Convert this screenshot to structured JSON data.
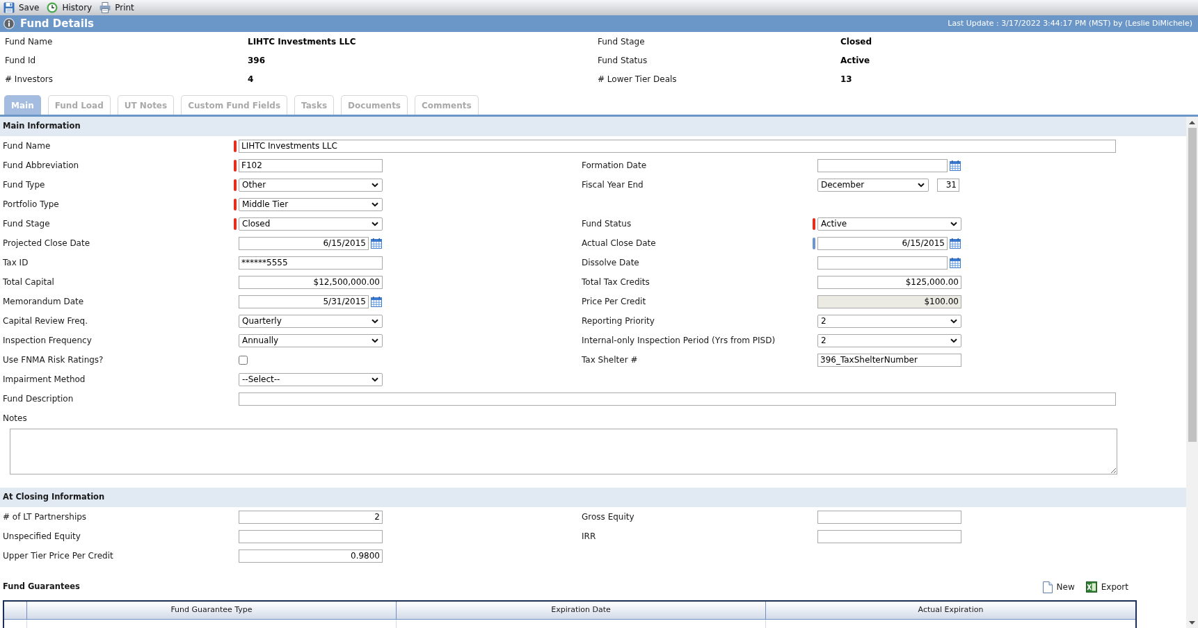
{
  "toolbar": [
    {
      "label": "Save"
    },
    {
      "label": "History"
    },
    {
      "label": "Print"
    }
  ],
  "header": {
    "title": "Fund Details",
    "last_update": "Last Update : 3/17/2022 3:44:17 PM (MST) by (Leslie DiMichele)"
  },
  "summary": [
    {
      "label": "Fund Name",
      "value": "LIHTC Investments LLC"
    },
    {
      "label": "Fund Stage",
      "value": "Closed"
    },
    {
      "label": "Fund Id",
      "value": "396"
    },
    {
      "label": "Fund Status",
      "value": "Active"
    },
    {
      "label": "# Investors",
      "value": "4"
    },
    {
      "label": "# Lower Tier Deals",
      "value": "13"
    }
  ],
  "tabs": [
    {
      "label": "Main",
      "selected": true
    },
    {
      "label": "Fund Load",
      "selected": false
    },
    {
      "label": "UT Notes",
      "selected": false
    },
    {
      "label": "Custom Fund Fields",
      "selected": false
    },
    {
      "label": "Tasks",
      "selected": false
    },
    {
      "label": "Documents",
      "selected": false
    },
    {
      "label": "Comments",
      "selected": false
    }
  ],
  "sections": [
    {
      "title": "Main Information",
      "rows": [
        {
          "wide": {
            "label": "Fund Name",
            "kind": "text",
            "value": "LIHTC Investments LLC",
            "disabled": false,
            "marker": {
              "color": "#e62e1f"
            }
          }
        },
        {
          "left": {
            "label": "Fund Abbreviation",
            "kind": "text",
            "value": "F102",
            "disabled": false,
            "marker": {
              "color": "#e62e1f"
            }
          },
          "right": {
            "label": "Formation Date",
            "kind": "date",
            "disabled": false
          }
        },
        {
          "left": {
            "label": "Fund Type",
            "kind": "select",
            "value": "Other",
            "disabled": false,
            "marker": {
              "color": "#e62e1f"
            }
          },
          "right": {
            "label": "Fiscal Year End",
            "kind": "month_day",
            "value": "December",
            "day": "31",
            "disabled": false
          }
        },
        {
          "left": {
            "label": "Portfolio Type",
            "kind": "select",
            "value": "Middle Tier",
            "disabled": false,
            "marker": {
              "color": "#e62e1f"
            }
          }
        },
        {
          "left": {
            "label": "Fund Stage",
            "kind": "select",
            "value": "Closed",
            "disabled": false,
            "marker": {
              "color": "#e62e1f"
            }
          },
          "right": {
            "label": "Fund Status",
            "kind": "select",
            "value": "Active",
            "disabled": false,
            "marker": {
              "color": "#e62e1f"
            }
          }
        },
        {
          "left": {
            "label": "Projected Close Date",
            "kind": "date",
            "value": "6/15/2015",
            "disabled": false
          },
          "right": {
            "label": "Actual Close Date",
            "kind": "date",
            "value": "6/15/2015",
            "disabled": false,
            "marker": {
              "color": "#6f96c9"
            }
          }
        },
        {
          "left": {
            "label": "Tax ID",
            "kind": "text",
            "value": "******5555",
            "disabled": false
          },
          "right": {
            "label": "Dissolve Date",
            "kind": "date",
            "disabled": false
          }
        },
        {
          "left": {
            "label": "Total Capital",
            "kind": "number",
            "value": "$12,500,000.00",
            "disabled": false
          },
          "right": {
            "label": "Total Tax Credits",
            "kind": "number",
            "value": "$125,000.00",
            "disabled": false
          }
        },
        {
          "left": {
            "label": "Memorandum Date",
            "kind": "date",
            "value": "5/31/2015",
            "disabled": false
          },
          "right": {
            "label": "Price Per Credit",
            "kind": "number",
            "value": "$100.00",
            "disabled": true
          }
        },
        {
          "left": {
            "label": "Capital Review Freq.",
            "kind": "select",
            "value": "Quarterly",
            "disabled": false
          },
          "right": {
            "label": "Reporting Priority",
            "kind": "select",
            "value": "2",
            "disabled": false
          }
        },
        {
          "left": {
            "label": "Inspection Frequency",
            "kind": "select",
            "value": "Annually",
            "disabled": false
          },
          "right": {
            "label": "Internal-only Inspection Period (Yrs from PISD)",
            "kind": "select",
            "value": "2",
            "disabled": false
          }
        },
        {
          "left": {
            "label": "Use FNMA Risk Ratings?",
            "kind": "checkbox",
            "checked": false,
            "disabled": false
          },
          "right": {
            "label": "Tax Shelter #",
            "kind": "text",
            "value": "396_TaxShelterNumber",
            "disabled": false
          }
        },
        {
          "left": {
            "label": "Impairment Method",
            "kind": "select",
            "value": "--Select--",
            "disabled": false
          }
        },
        {
          "wide": {
            "label": "Fund Description",
            "kind": "text",
            "disabled": false
          }
        },
        {
          "wide": {
            "label": "Notes",
            "kind": "textarea",
            "disabled": false
          }
        }
      ]
    },
    {
      "title": "At Closing Information",
      "rows": [
        {
          "left": {
            "label": "# of LT Partnerships",
            "kind": "number",
            "value": "2",
            "disabled": false
          },
          "right": {
            "label": "Gross Equity",
            "kind": "text",
            "disabled": false
          }
        },
        {
          "left": {
            "label": "Unspecified Equity",
            "kind": "text",
            "disabled": false
          },
          "right": {
            "label": "IRR",
            "kind": "text",
            "disabled": false
          }
        },
        {
          "left": {
            "label": "Upper Tier Price Per Credit",
            "kind": "number",
            "value": "0.9800",
            "disabled": false
          }
        }
      ]
    }
  ],
  "guarantees": {
    "title": "Fund Guarantees",
    "actions": [
      {
        "label": "New"
      },
      {
        "label": "Export"
      }
    ],
    "columns": [
      "Fund Guarantee Type",
      "Expiration Date",
      "Actual Expiration"
    ]
  }
}
